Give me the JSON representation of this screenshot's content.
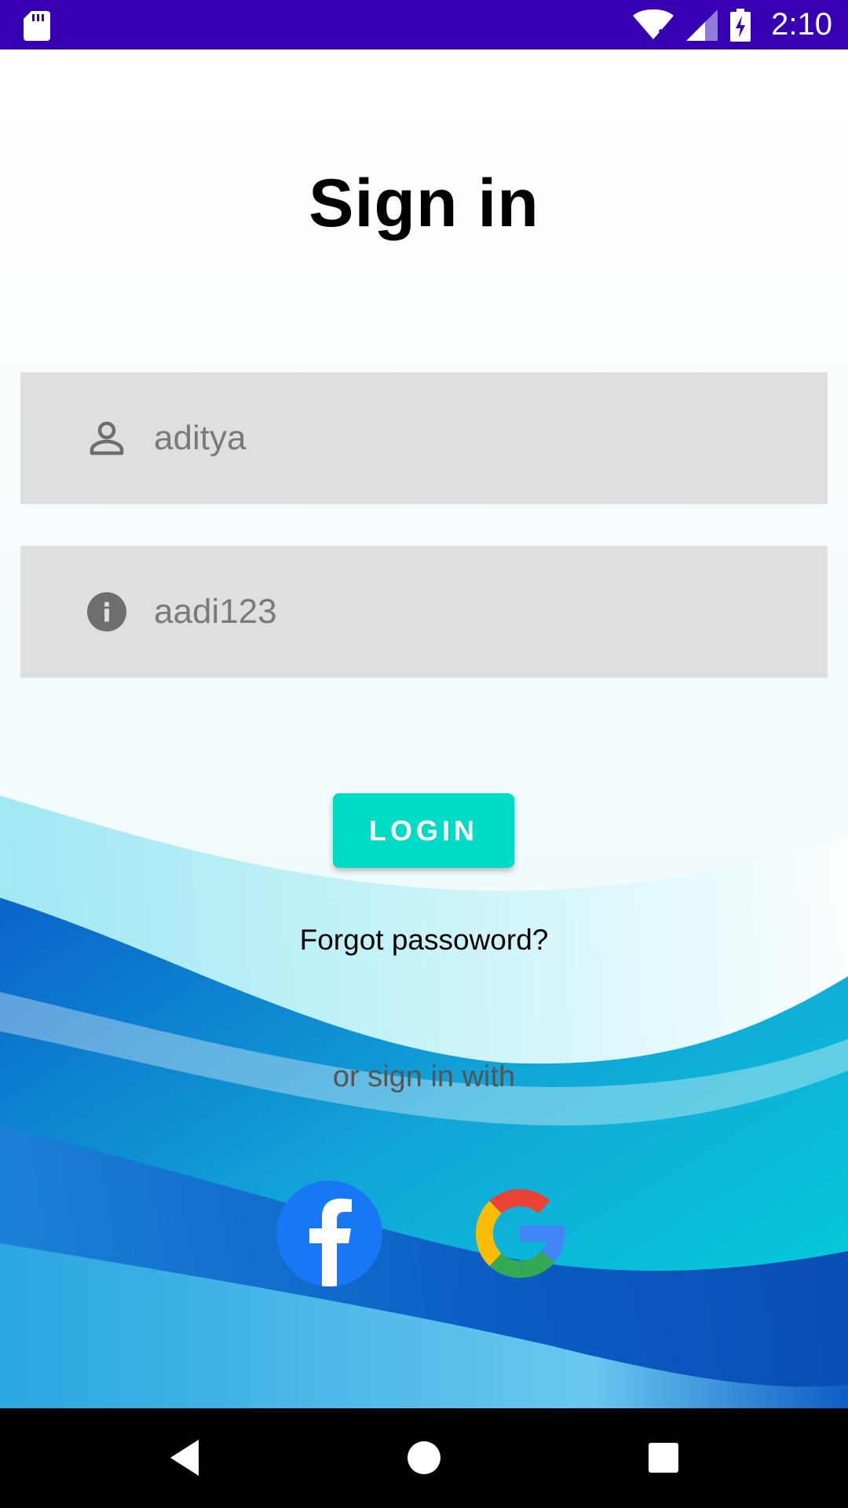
{
  "status_bar": {
    "time": "2:10",
    "icons": [
      "sd-card-icon",
      "wifi-off-icon",
      "cellular-signal-icon",
      "battery-charging-icon"
    ]
  },
  "colors": {
    "status_bar": "#3700b3",
    "login_button": "#00dbc5",
    "field_background": "#dedede",
    "nav_bar": "#000000"
  },
  "page": {
    "title": "Sign in"
  },
  "form": {
    "username": {
      "icon": "person-icon",
      "value": "aditya"
    },
    "password": {
      "icon": "info-icon",
      "value": "aadi123"
    },
    "login_label": "LOGIN",
    "forgot_label": "Forgot passoword?"
  },
  "social": {
    "label": "or sign in with",
    "providers": [
      {
        "name": "facebook",
        "icon": "facebook-icon"
      },
      {
        "name": "google",
        "icon": "google-icon"
      }
    ]
  },
  "nav_bar": {
    "buttons": [
      "back-icon",
      "home-icon",
      "recents-icon"
    ]
  }
}
